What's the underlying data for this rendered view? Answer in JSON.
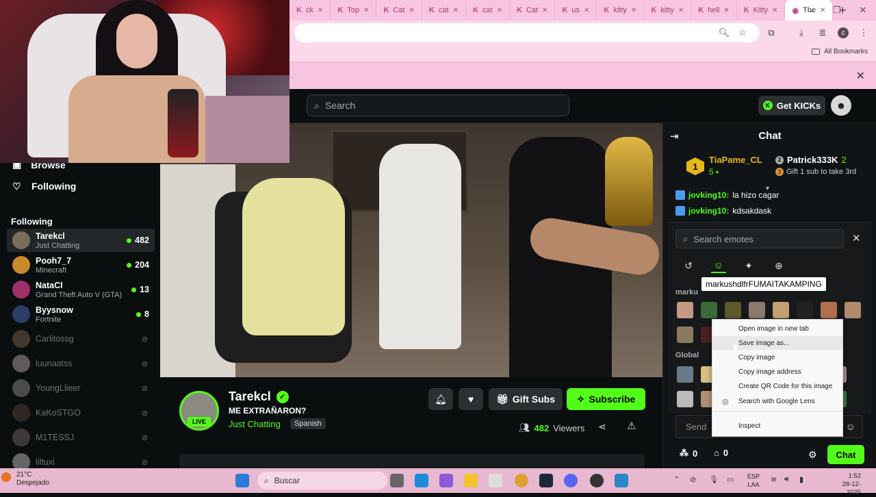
{
  "browser": {
    "tabs": [
      {
        "label": "ck",
        "icon": "kick-icon"
      },
      {
        "label": "Top",
        "icon": "kick-icon"
      },
      {
        "label": "Cat",
        "icon": "kick-icon"
      },
      {
        "label": "cat",
        "icon": "kick-icon"
      },
      {
        "label": "cat",
        "icon": "kick-icon"
      },
      {
        "label": "Cat",
        "icon": "kick-icon"
      },
      {
        "label": "us",
        "icon": "kick-icon"
      },
      {
        "label": "kitty",
        "icon": "kick-icon"
      },
      {
        "label": "kitty",
        "icon": "kick-icon"
      },
      {
        "label": "hell",
        "icon": "kick-icon"
      },
      {
        "label": "Kitty",
        "icon": "kick-icon"
      },
      {
        "label": "The",
        "icon": "page-icon"
      }
    ],
    "new_tab": "+",
    "profile_initial": "c",
    "all_bookmarks": "All Bookmarks"
  },
  "kick": {
    "search_placeholder": "Search",
    "get_kicks": "Get KICKs"
  },
  "sidebar": {
    "browse": "Browse",
    "following_nav": "Following",
    "heading": "Following",
    "channels": [
      {
        "name": "Tarekcl",
        "category": "Just Chatting",
        "viewers": "482",
        "live": true,
        "avatar_color": "#7a6d5c"
      },
      {
        "name": "Pooh7_7",
        "category": "Minecraft",
        "viewers": "204",
        "live": true,
        "avatar_color": "#c98a2e"
      },
      {
        "name": "NataCl",
        "category": "Grand Theft Auto V (GTA)",
        "viewers": "13",
        "live": true,
        "avatar_color": "#a0306a"
      },
      {
        "name": "Byysnow",
        "category": "Fortnite",
        "viewers": "8",
        "live": true,
        "avatar_color": "#2c3e66"
      },
      {
        "name": "Carlitossg",
        "live": false,
        "avatar_color": "#886a55"
      },
      {
        "name": "luunaatss",
        "live": false,
        "avatar_color": "#c7b7c0"
      },
      {
        "name": "YoungLlieer",
        "live": false,
        "avatar_color": "#9a9a9a"
      },
      {
        "name": "KaKoSTGO",
        "live": false,
        "avatar_color": "#5a4a3a"
      },
      {
        "name": "M1TESSJ",
        "live": false,
        "avatar_color": "#7a6e6a"
      },
      {
        "name": "liltuxi",
        "live": false,
        "avatar_color": "#d0d0d0"
      }
    ]
  },
  "channel": {
    "name": "Tarekcl",
    "live_badge": "LIVE",
    "title": "ME EXTRAÑARON?",
    "category": "Just Chatting",
    "language": "Spanish",
    "gift_subs": "Gift Subs",
    "subscribe": "Subscribe",
    "viewers_count": "482",
    "viewers_label": "Viewers"
  },
  "chat": {
    "header": "Chat",
    "pinned": {
      "rank": "1",
      "name": "TiaPame_CL",
      "count": "5",
      "second_name": "Patrick333K",
      "second_count": "2",
      "gift_text": "Gift 1 sub to take 3rd",
      "coin": "3"
    },
    "messages": [
      {
        "user": "jovking10:",
        "text": "la hizo cagar"
      },
      {
        "user": "jovking10:",
        "text": "kdsakdask"
      }
    ],
    "emote_search_placeholder": "Search emotes",
    "emote_section_channel": "marku",
    "tooltip": "markushdlfrFUMAITAKAMPING",
    "emote_section_global": "Global",
    "input_placeholder": "Send",
    "footer_count_a": "0",
    "footer_count_b": "0",
    "chat_button": "Chat"
  },
  "context_menu": {
    "items": [
      "Open image in new tab",
      "Save image as...",
      "Copy image",
      "Copy image address",
      "Create QR Code for this image",
      "Search with Google Lens",
      "Inspect"
    ]
  },
  "taskbar": {
    "temperature": "21°C",
    "condition": "Despejado",
    "search_placeholder": "Buscar",
    "lang_top": "ESP",
    "lang_bottom": "LAA",
    "time": "1:52",
    "date": "28-12-2025"
  },
  "colors": {
    "kick_green": "#53fc18",
    "chrome_pink": "#f7c5e1",
    "background": "#0b0e0f"
  }
}
